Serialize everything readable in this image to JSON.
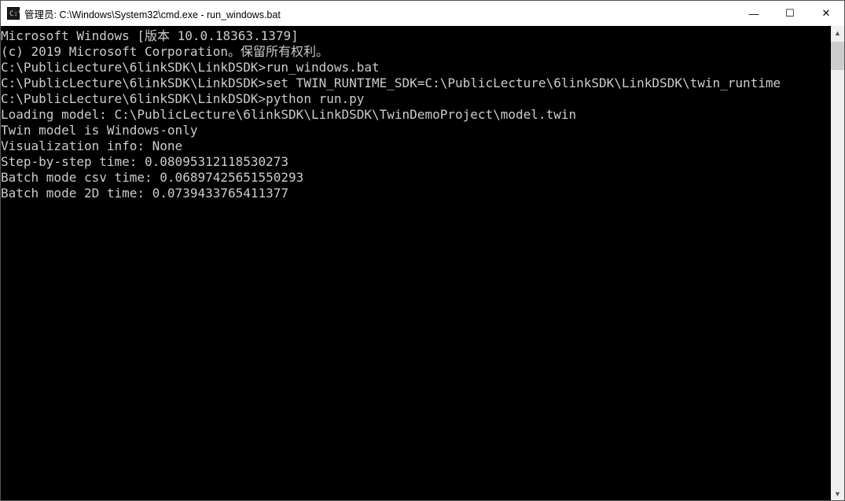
{
  "window": {
    "title": "管理员: C:\\Windows\\System32\\cmd.exe - run_windows.bat",
    "min": "—",
    "max": "☐",
    "close": "✕"
  },
  "icon": "cmd-icon",
  "terminal": {
    "lines": [
      "Microsoft Windows [版本 10.0.18363.1379]",
      "(c) 2019 Microsoft Corporation。保留所有权利。",
      "",
      "C:\\PublicLecture\\6linkSDK\\LinkDSDK>run_windows.bat",
      "",
      "C:\\PublicLecture\\6linkSDK\\LinkDSDK>set TWIN_RUNTIME_SDK=C:\\PublicLecture\\6linkSDK\\LinkDSDK\\twin_runtime",
      "",
      "C:\\PublicLecture\\6linkSDK\\LinkDSDK>python run.py",
      "Loading model: C:\\PublicLecture\\6linkSDK\\LinkDSDK\\TwinDemoProject\\model.twin",
      "Twin model is Windows-only",
      "Visualization info: None",
      "Step-by-step time: 0.08095312118530273",
      "Batch mode csv time: 0.06897425651550293",
      "Batch mode 2D time: 0.0739433765411377"
    ]
  },
  "scrollbar": {
    "up": "▲",
    "down": "▼"
  }
}
